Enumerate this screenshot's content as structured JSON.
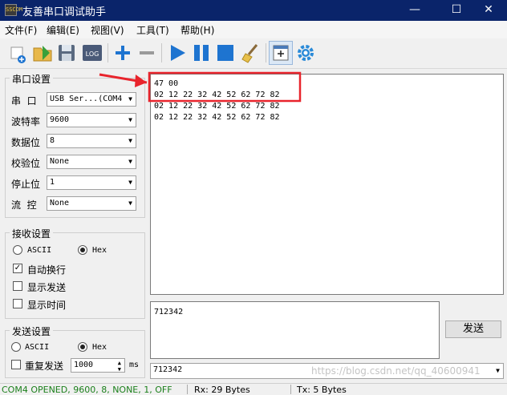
{
  "window": {
    "title": "友善串口调试助手",
    "icon": "SSCOM"
  },
  "title_buttons": {
    "minimize": "—",
    "maximize": "☐",
    "close": "✕"
  },
  "menu": [
    "文件(F)",
    "编辑(E)",
    "视图(V)",
    "工具(T)",
    "帮助(H)"
  ],
  "toolbar": {
    "icons": [
      "new-session-icon",
      "open-folder-icon",
      "save-icon",
      "log-icon",
      "add-icon",
      "remove-icon",
      "play-icon",
      "pause-icon",
      "stop-icon",
      "clear-broom-icon",
      "new-window-icon",
      "settings-gear-icon"
    ],
    "log_label": "LOG"
  },
  "serial": {
    "group_title": "串口设置",
    "port_label": "串  口",
    "port_value": "USB Ser...(COM4",
    "baud_label": "波特率",
    "baud_value": "9600",
    "databits_label": "数据位",
    "databits_value": "8",
    "parity_label": "校验位",
    "parity_value": "None",
    "stopbits_label": "停止位",
    "stopbits_value": "1",
    "flow_label": "流  控",
    "flow_value": "None"
  },
  "receive": {
    "group_title": "接收设置",
    "ascii_label": "ASCII",
    "hex_label": "Hex",
    "selected": "Hex",
    "autowrap_label": "自动换行",
    "autowrap_checked": true,
    "show_send_label": "显示发送",
    "show_send_checked": false,
    "show_time_label": "显示时间",
    "show_time_checked": false
  },
  "send": {
    "group_title": "发送设置",
    "ascii_label": "ASCII",
    "hex_label": "Hex",
    "selected": "Hex",
    "repeat_label": "重复发送",
    "repeat_checked": false,
    "interval_value": "1000",
    "interval_unit": "ms",
    "button_label": "发送"
  },
  "receive_lines": [
    "47 00",
    "02 12 22 32 42 52 62 72 82",
    "02 12 22 32 42 52 62 72 82",
    "02 12 22 32 42 52 62 72 82"
  ],
  "send_text": "712342",
  "history_value": "712342",
  "watermark": "https://blog.csdn.net/qq_40600941",
  "status": {
    "port": "COM4 OPENED, 9600, 8, NONE, 1, OFF",
    "rx": "Rx: 29 Bytes",
    "tx": "Tx: 5 Bytes"
  },
  "colors": {
    "titlebar": "#0a246a",
    "annotation_red": "#e8242c",
    "status_green": "#1a7f1a",
    "accent_blue": "#1e74d0"
  }
}
